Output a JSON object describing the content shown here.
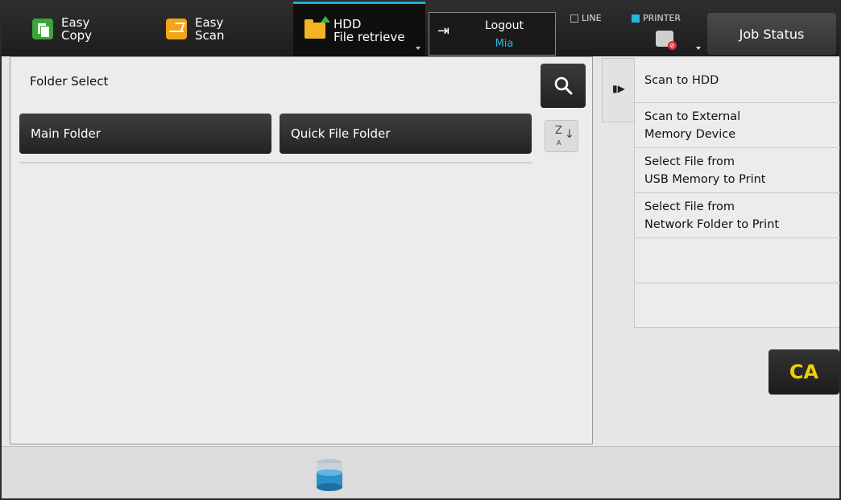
{
  "header": {
    "modes": [
      {
        "line1": "Easy",
        "line2": "Copy",
        "icon": "copy-icon",
        "color": "#3aa53a"
      },
      {
        "line1": "Easy",
        "line2": "Scan",
        "icon": "scan-icon",
        "color": "#f2a51a"
      },
      {
        "line1": "HDD",
        "line2": "File retrieve",
        "icon": "folder-icon",
        "active": true
      }
    ],
    "logout": {
      "label": "Logout",
      "user": "Mia"
    },
    "status": {
      "line": "LINE",
      "printer": "PRINTER"
    },
    "job_status": "Job Status",
    "accent_color": "#1ab0d6"
  },
  "main": {
    "title": "Folder Select",
    "folders": [
      {
        "label": "Main Folder"
      },
      {
        "label": "Quick File Folder"
      }
    ],
    "sort": {
      "top": "Z",
      "bottom": "A"
    }
  },
  "side_menu": {
    "items": [
      {
        "label": "Scan to HDD"
      },
      {
        "label": "Scan to External\nMemory Device"
      },
      {
        "label": "Select File from\nUSB Memory to Print"
      },
      {
        "label": "Select File from\nNetwork Folder to Print"
      },
      {
        "label": ""
      },
      {
        "label": ""
      }
    ]
  },
  "ca_button": "CA"
}
